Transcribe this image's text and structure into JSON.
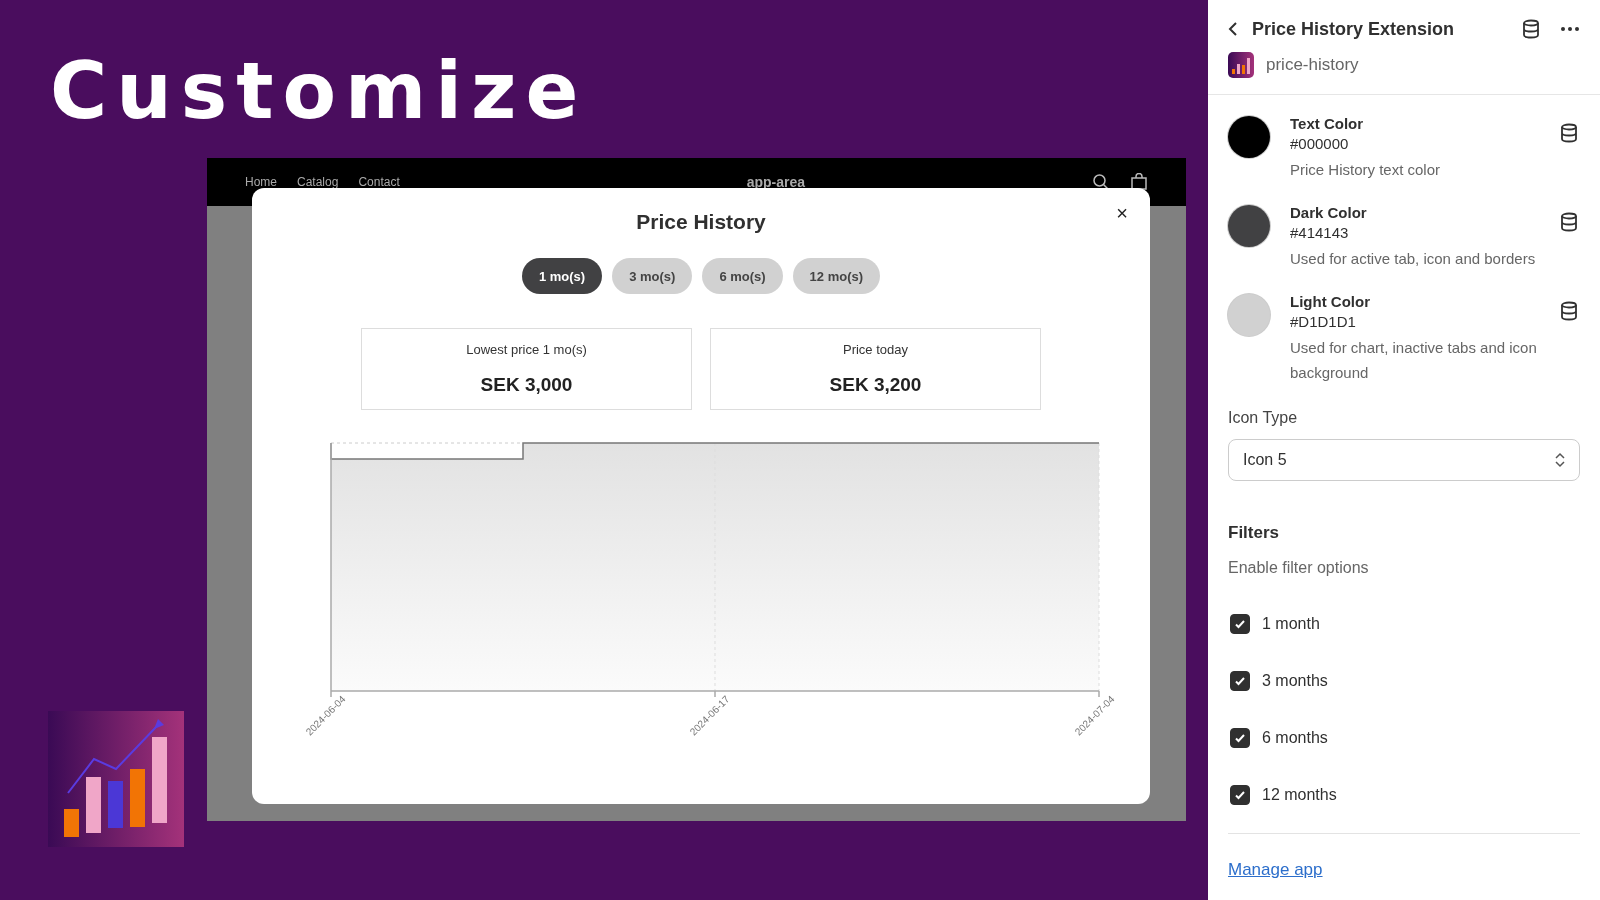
{
  "headline": "Customize",
  "store": {
    "nav": [
      "Home",
      "Catalog",
      "Contact"
    ],
    "brand": "app-area"
  },
  "modal": {
    "title": "Price History",
    "close": "×",
    "tabs": [
      {
        "label": "1 mo(s)",
        "selected": true
      },
      {
        "label": "3 mo(s)",
        "selected": false
      },
      {
        "label": "6 mo(s)",
        "selected": false
      },
      {
        "label": "12 mo(s)",
        "selected": false
      }
    ],
    "cards": [
      {
        "label": "Lowest price 1 mo(s)",
        "value": "SEK 3,000"
      },
      {
        "label": "Price today",
        "value": "SEK 3,200"
      }
    ],
    "chart": {
      "x_labels": [
        "2024-06-04",
        "2024-06-17",
        "2024-07-04"
      ]
    }
  },
  "panel": {
    "title": "Price History Extension",
    "app_name": "price-history",
    "colors": [
      {
        "name": "Text Color",
        "hex": "#000000",
        "color": "#000000",
        "description": "Price History text color"
      },
      {
        "name": "Dark Color",
        "hex": "#414143",
        "color": "#414143",
        "description": "Used for active tab, icon and borders"
      },
      {
        "name": "Light Color",
        "hex": "#D1D1D1",
        "color": "#d1d1d1",
        "description": "Used for chart, inactive tabs and icon background"
      }
    ],
    "icon_type": {
      "label": "Icon Type",
      "value": "Icon 5"
    },
    "filters": {
      "title": "Filters",
      "subtitle": "Enable filter options",
      "options": [
        {
          "label": "1 month",
          "checked": true
        },
        {
          "label": "3 months",
          "checked": true
        },
        {
          "label": "6 months",
          "checked": true
        },
        {
          "label": "12 months",
          "checked": true
        }
      ]
    },
    "link": "Manage app"
  }
}
